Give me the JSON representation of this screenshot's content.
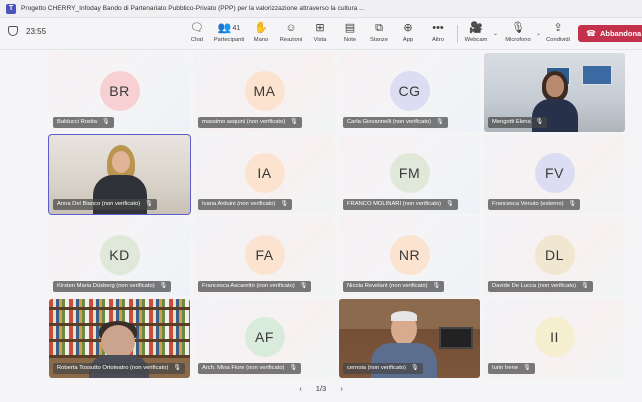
{
  "window": {
    "title": "Progetto CHERRY_Infoday Bando di Partenariato Pubblico-Privato (PPP) per la valorizzazione attraverso la cultura ..."
  },
  "meeting": {
    "timer": "23:55",
    "toolbar": {
      "chat": "Chat",
      "participants": "Partecipanti",
      "participants_count": "41",
      "hand": "Mano",
      "reactions": "Reazioni",
      "view": "Vista",
      "notes": "Note",
      "rooms": "Stanze",
      "apps": "App",
      "more": "Altro",
      "camera": "Webcam",
      "mic": "Microfono",
      "share": "Condividi",
      "leave": "Abbandona"
    }
  },
  "tiles": [
    {
      "name": "Balducci Rosita",
      "initials": "BR",
      "avatar_color": "#f7d0d4"
    },
    {
      "name": "massimo asquini (non verificato)",
      "initials": "MA",
      "avatar_color": "#fbe3cf"
    },
    {
      "name": "Carla Giovannelli (non verificato)",
      "initials": "CG",
      "avatar_color": "#dcdcf2"
    },
    {
      "name": "Mengotti Elena",
      "initials": "",
      "video": "office"
    },
    {
      "name": "Anna Del Bianco (non verificato)",
      "initials": "",
      "video": "anna",
      "selected": true
    },
    {
      "name": "Ivana Arduini (non verificato)",
      "initials": "IA",
      "avatar_color": "#fbe3cf"
    },
    {
      "name": "FRANCO MOLINARI (non verificato)",
      "initials": "FM",
      "avatar_color": "#dfe8d9"
    },
    {
      "name": "Francesca Venuto (esterno)",
      "initials": "FV",
      "avatar_color": "#dcdcf2"
    },
    {
      "name": "Kirsten Maria Düsberg (non verificato)",
      "initials": "KD",
      "avatar_color": "#dfe8d9"
    },
    {
      "name": "Francesca Ascaretto (non verificato)",
      "initials": "FA",
      "avatar_color": "#fbe3cf"
    },
    {
      "name": "Nicola Revelant (non verificato)",
      "initials": "NR",
      "avatar_color": "#fbe3cf"
    },
    {
      "name": "Davide De Lucca (non verificato)",
      "initials": "DL",
      "avatar_color": "#f1e6cf"
    },
    {
      "name": "Roberta Tossutto Ortoteatro (non verificato)",
      "initials": "",
      "video": "books"
    },
    {
      "name": "Arch. Mina Fiore (non verificato)",
      "initials": "AF",
      "avatar_color": "#d9ecdc"
    },
    {
      "name": "cernoia (non verificato)",
      "initials": "",
      "video": "cernoia"
    },
    {
      "name": "Iurin Irene",
      "initials": "II",
      "avatar_color": "#f6efcf"
    }
  ],
  "pager": {
    "label": "1/3"
  }
}
